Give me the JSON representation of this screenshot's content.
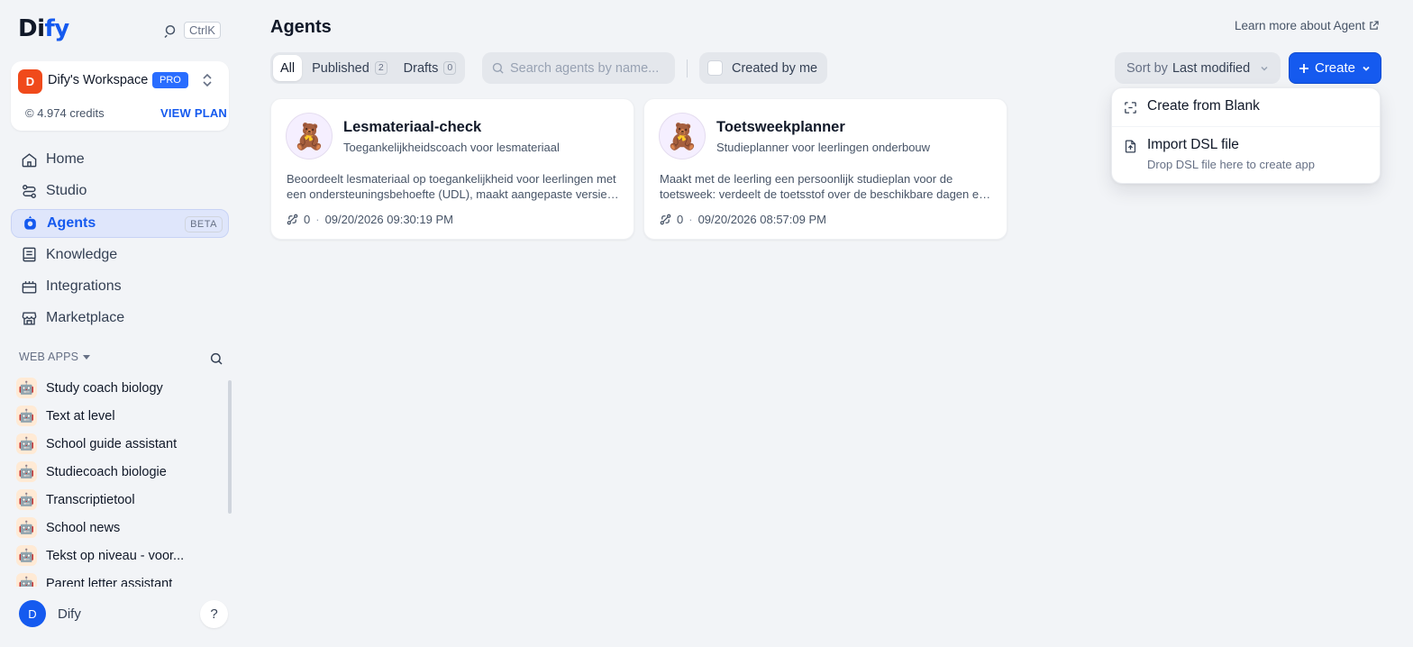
{
  "sidebar": {
    "logo": {
      "part1": "Di",
      "part2": "fy"
    },
    "shortcut": "CtrlK",
    "workspace": {
      "avatar_letter": "D",
      "name": "Dify's Workspace",
      "plan_badge": "PRO",
      "credits": "4.974 credits",
      "view_plan": "VIEW PLAN"
    },
    "nav": [
      {
        "label": "Home",
        "icon": "home-icon"
      },
      {
        "label": "Studio",
        "icon": "studio-icon"
      },
      {
        "label": "Agents",
        "icon": "agent-icon",
        "badge": "BETA",
        "active": true
      },
      {
        "label": "Knowledge",
        "icon": "book-icon"
      },
      {
        "label": "Integrations",
        "icon": "briefcase-icon"
      },
      {
        "label": "Marketplace",
        "icon": "store-icon"
      }
    ],
    "web_apps_title": "WEB APPS",
    "web_apps": [
      "Study coach biology",
      "Text at level",
      "School guide assistant",
      "Studiecoach biologie",
      "Transcriptietool",
      "School news",
      "Tekst op niveau - voor...",
      "Parent letter assistant"
    ],
    "user": {
      "avatar_letter": "D",
      "name": "Dify"
    },
    "help_label": "?"
  },
  "header": {
    "title": "Agents",
    "learn_more": "Learn more about Agent"
  },
  "toolbar": {
    "tabs": [
      {
        "label": "All",
        "active": true
      },
      {
        "label": "Published",
        "count": "2"
      },
      {
        "label": "Drafts",
        "count": "0"
      }
    ],
    "search_placeholder": "Search agents by name...",
    "created_by_me": "Created by me",
    "sort_prefix": "Sort by",
    "sort_value": "Last modified",
    "create_label": "Create"
  },
  "create_menu": {
    "blank": "Create from Blank",
    "import_title": "Import DSL file",
    "import_sub": "Drop DSL file here to create app"
  },
  "cards": [
    {
      "title": "Lesmateriaal-check",
      "subtitle": "Toegankelijkheidscoach voor lesmateriaal",
      "description": "Beoordeelt lesmateriaal op toegankelijkheid voor leerlingen met een ondersteuningsbehoefte (UDL), maakt aangepaste versies van het materiaal",
      "count": "0",
      "date": "09/20/2026 09:30:19 PM"
    },
    {
      "title": "Toetsweekplanner",
      "subtitle": "Studieplanner voor leerlingen onderbouw",
      "description": "Maakt met de leerling een persoonlijk studieplan voor de toetsweek: verdeelt de toetsstof over de beschikbare dagen en houdt rekening met",
      "count": "0",
      "date": "09/20/2026 08:57:09 PM"
    }
  ],
  "colors": {
    "accent": "#155aef",
    "workspace_avatar": "#f04a1b",
    "background": "#f2f4f7"
  }
}
